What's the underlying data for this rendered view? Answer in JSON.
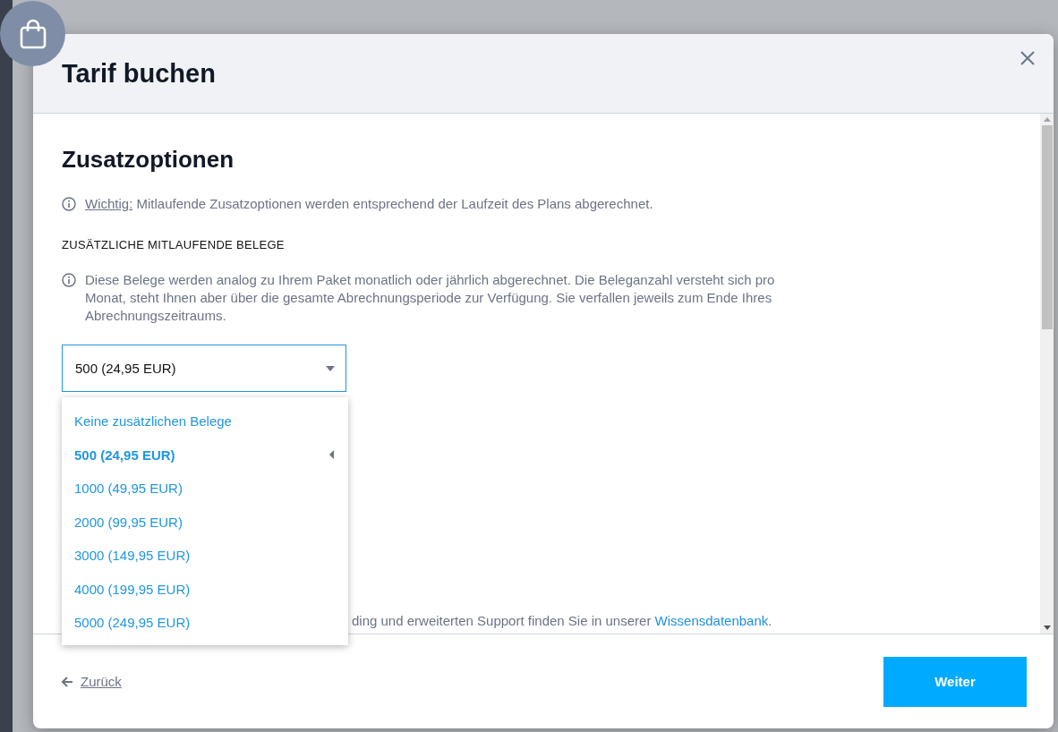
{
  "dialog": {
    "title": "Tarif buchen"
  },
  "section": {
    "title": "Zusatzoptionen",
    "notice": {
      "label": "Wichtig:",
      "text": "Mitlaufende Zusatzoptionen werden entsprechend der Laufzeit des Plans abgerechnet."
    },
    "field_label": "ZUSÄTZLICHE MITLAUFENDE BELEGE",
    "hint": "Diese Belege werden analog zu Ihrem Paket monatlich oder jährlich abgerechnet. Die Beleganzahl versteht sich pro Monat, steht Ihnen aber über die gesamte Abrechnungsperiode zur Verfügung. Sie verfallen jeweils zum Ende Ihres Abrechnungszeitraums.",
    "select": {
      "value": "500 (24,95 EUR)",
      "expanded": true,
      "options": [
        {
          "label": "Keine zusätzlichen Belege",
          "selected": false
        },
        {
          "label": "500 (24,95 EUR)",
          "selected": true
        },
        {
          "label": "1000 (49,95 EUR)",
          "selected": false
        },
        {
          "label": "2000 (99,95 EUR)",
          "selected": false
        },
        {
          "label": "3000 (149,95 EUR)",
          "selected": false
        },
        {
          "label": "4000 (199,95 EUR)",
          "selected": false
        },
        {
          "label": "5000 (249,95 EUR)",
          "selected": false
        }
      ]
    },
    "footnote": {
      "text": "ding und erweiterten Support finden Sie in unserer ",
      "link": "Wissensdatenbank",
      "end": "."
    }
  },
  "footer": {
    "back": "Zurück",
    "next": "Weiter"
  }
}
